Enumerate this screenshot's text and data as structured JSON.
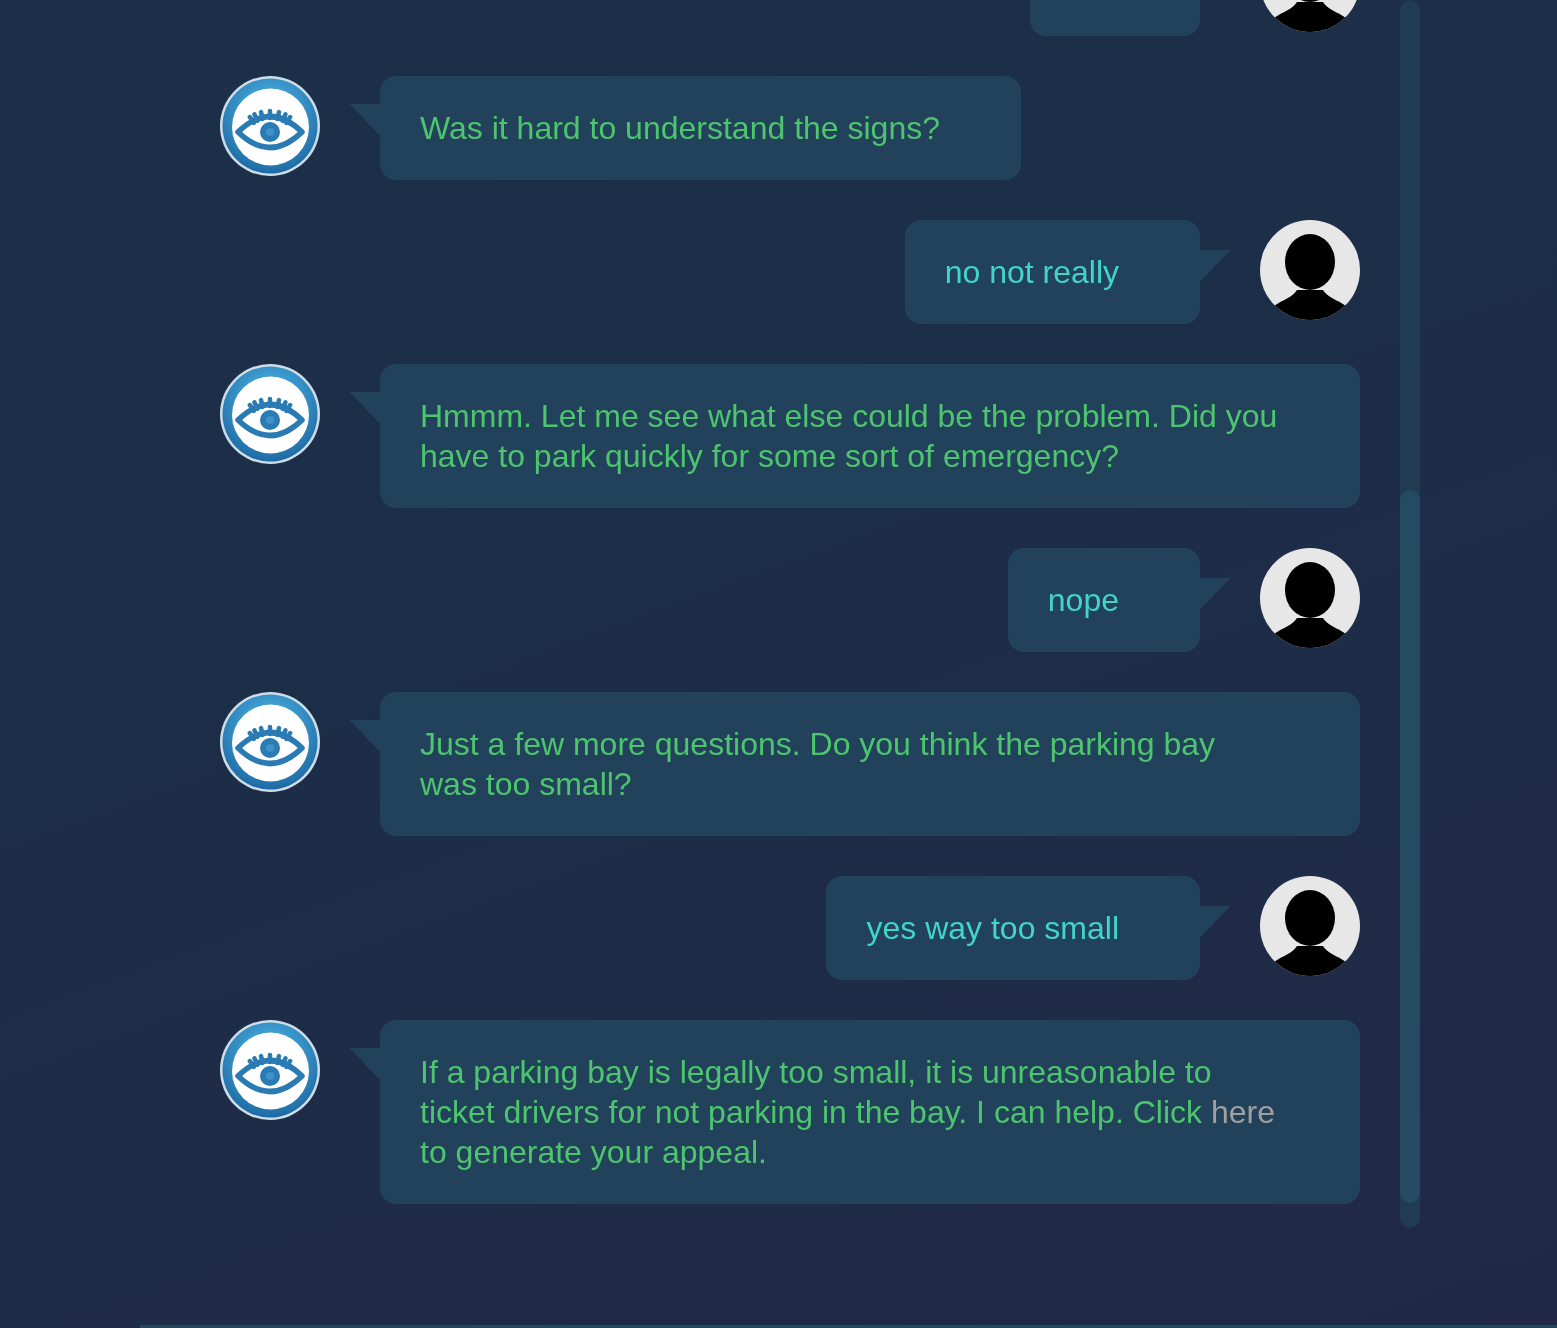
{
  "messages": [
    {
      "kind": "user"
    },
    {
      "kind": "bot",
      "parts": [
        {
          "kind": "text",
          "text": "Was it hard to understand the signs?"
        }
      ]
    },
    {
      "kind": "user",
      "parts": [
        {
          "kind": "text",
          "text": "no not really"
        }
      ]
    },
    {
      "kind": "bot",
      "parts": [
        {
          "kind": "text",
          "text": "Hmmm. Let me see what else could be the problem. Did you have to park quickly for some sort of emergency?"
        }
      ]
    },
    {
      "kind": "user",
      "parts": [
        {
          "kind": "text",
          "text": "nope"
        }
      ]
    },
    {
      "kind": "bot",
      "parts": [
        {
          "kind": "text",
          "text": "Just a few more questions. Do you think the parking bay was too small?"
        }
      ]
    },
    {
      "kind": "user",
      "parts": [
        {
          "kind": "text",
          "text": "yes way too small"
        }
      ]
    },
    {
      "kind": "bot",
      "parts": [
        {
          "kind": "text",
          "text": "If a parking bay is legally too small, it is unreasonable to ticket drivers for not parking in the bay. I can help. Click "
        },
        {
          "kind": "link",
          "text": "here"
        },
        {
          "kind": "text",
          "text": " to generate your appeal."
        }
      ]
    }
  ]
}
